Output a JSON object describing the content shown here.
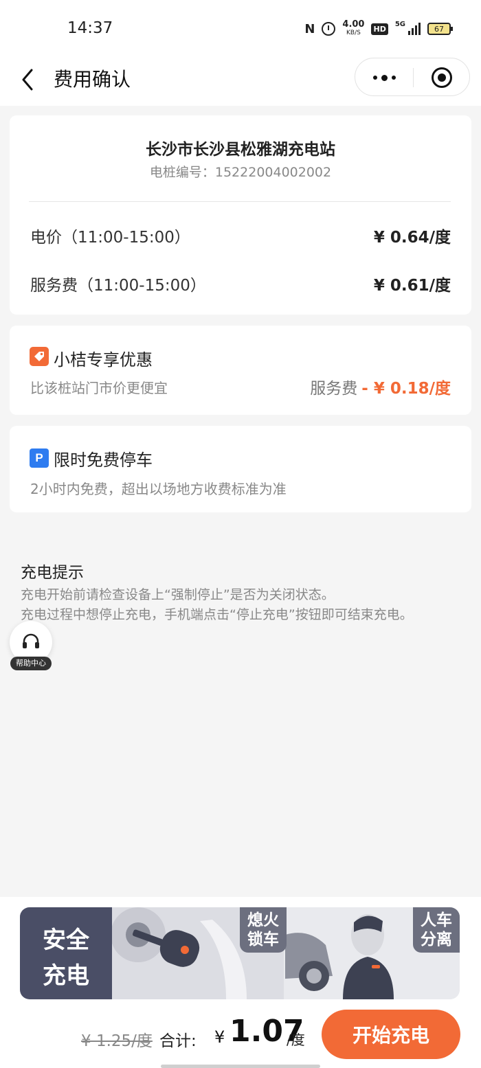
{
  "status_bar": {
    "time": "14:37",
    "net_speed": "4.00",
    "net_speed_unit": "KB/S",
    "hd": "HD",
    "network": "5G",
    "battery": "67"
  },
  "nav": {
    "title": "费用确认",
    "icons": [
      "back-icon",
      "more-icon",
      "mini-program-close-icon"
    ]
  },
  "station": {
    "name": "长沙市长沙县松雅湖充电站",
    "pile_no": "电桩编号：15222004002002",
    "prices": [
      {
        "label": "电价（11:00-15:00）",
        "value": "¥ 0.64/度"
      },
      {
        "label": "服务费（11:00-15:00）",
        "value": "¥ 0.61/度"
      }
    ]
  },
  "promo": {
    "title": "小桔专享优惠",
    "subtitle": "比该桩站门市价更便宜",
    "discount_label": "服务费",
    "discount_value": "- ¥ 0.18/度",
    "icon": "tag-icon",
    "accent": "#f26a36"
  },
  "parking": {
    "icon_letter": "P",
    "title": "限时免费停车",
    "subtitle": "2小时内免费，超出以场地方收费标准为准",
    "accent": "#2e7cf0"
  },
  "tips": {
    "title": "充电提示",
    "lines": [
      "充电开始前请检查设备上“强制停止”是否为关闭状态。",
      "充电过程中想停止充电，手机端点击“停止充电”按钮即可结束充电。"
    ]
  },
  "help": {
    "label": "帮助中心",
    "icon": "headset-icon"
  },
  "banner": {
    "left_line1": "安全",
    "left_line2": "充电",
    "tag_a_line1": "熄火",
    "tag_a_line2": "锁车",
    "tag_b_line1": "人车",
    "tag_b_line2": "分离"
  },
  "footer": {
    "original_price": "¥ 1.25/度",
    "total_label": "合计:",
    "currency": "¥",
    "total_value": "1.07",
    "unit": "/度",
    "start_button": "开始充电",
    "button_color": "#f26a36"
  }
}
